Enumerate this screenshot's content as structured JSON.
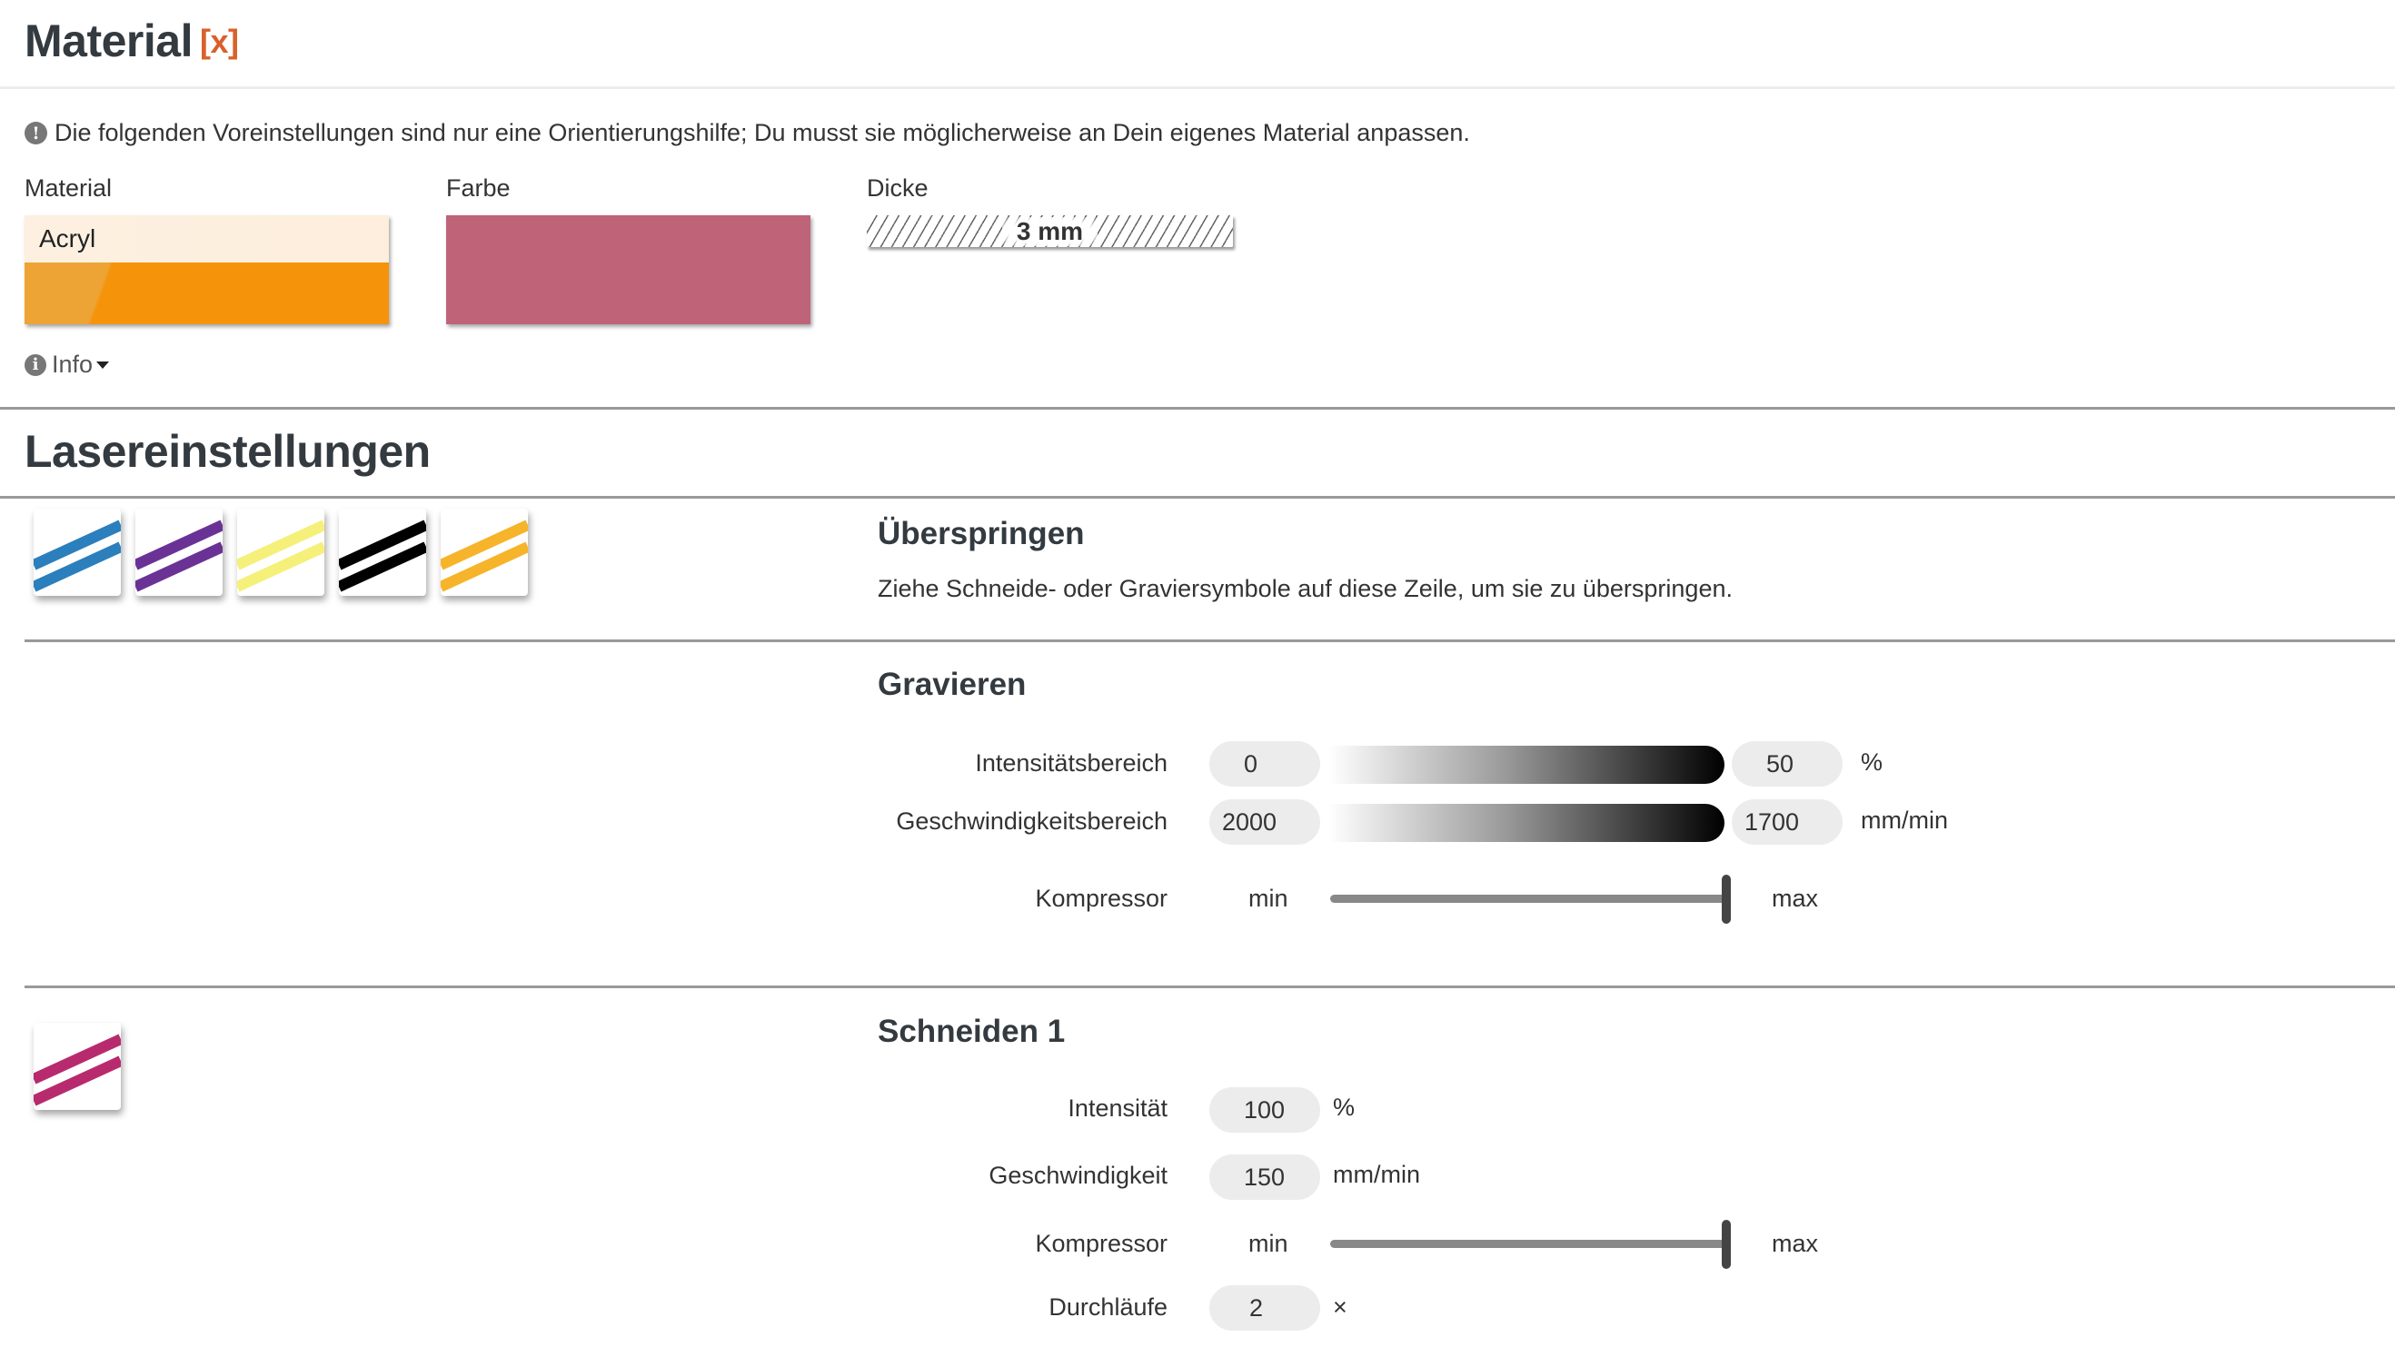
{
  "header": {
    "title": "Material",
    "close_label": "[x]"
  },
  "notice": {
    "icon": "exclamation-circle-icon",
    "text": "Die folgenden Voreinstellungen sind nur eine Orientierungshilfe; Du musst sie möglicherweise an Dein eigenes Material anpassen."
  },
  "material": {
    "label": "Material",
    "value": "Acryl",
    "accent_color": "#f5930a"
  },
  "color": {
    "label": "Farbe",
    "value": "#bf6478"
  },
  "thickness": {
    "label": "Dicke",
    "value": "3 mm"
  },
  "info": {
    "icon": "info-circle-icon",
    "label": "Info"
  },
  "laser": {
    "title": "Lasereinstellungen",
    "skip": {
      "title": "Überspringen",
      "hint": "Ziehe Schneide- oder Graviersymbole auf diese Zeile, um sie zu überspringen.",
      "symbols": [
        {
          "name": "blue",
          "color": "#2a7fbc"
        },
        {
          "name": "purple",
          "color": "#6b3296"
        },
        {
          "name": "yellow",
          "color": "#f5f07a"
        },
        {
          "name": "black",
          "color": "#000000"
        },
        {
          "name": "orange",
          "color": "#f6b42a"
        }
      ]
    },
    "engrave": {
      "title": "Gravieren",
      "intensity": {
        "label": "Intensitätsbereich",
        "min": "0",
        "max": "50",
        "unit": "%"
      },
      "speed": {
        "label": "Geschwindigkeitsbereich",
        "min": "2000",
        "max": "1700",
        "unit": "mm/min"
      },
      "compressor": {
        "label": "Kompressor",
        "min_label": "min",
        "max_label": "max",
        "level": 1.0
      }
    },
    "cut1": {
      "title": "Schneiden 1",
      "symbol": {
        "name": "magenta",
        "color": "#b82a6e"
      },
      "intensity": {
        "label": "Intensität",
        "value": "100",
        "unit": "%"
      },
      "speed": {
        "label": "Geschwindigkeit",
        "value": "150",
        "unit": "mm/min"
      },
      "compressor": {
        "label": "Kompressor",
        "min_label": "min",
        "max_label": "max",
        "level": 1.0
      },
      "passes": {
        "label": "Durchläufe",
        "value": "2",
        "unit": "×"
      }
    }
  }
}
